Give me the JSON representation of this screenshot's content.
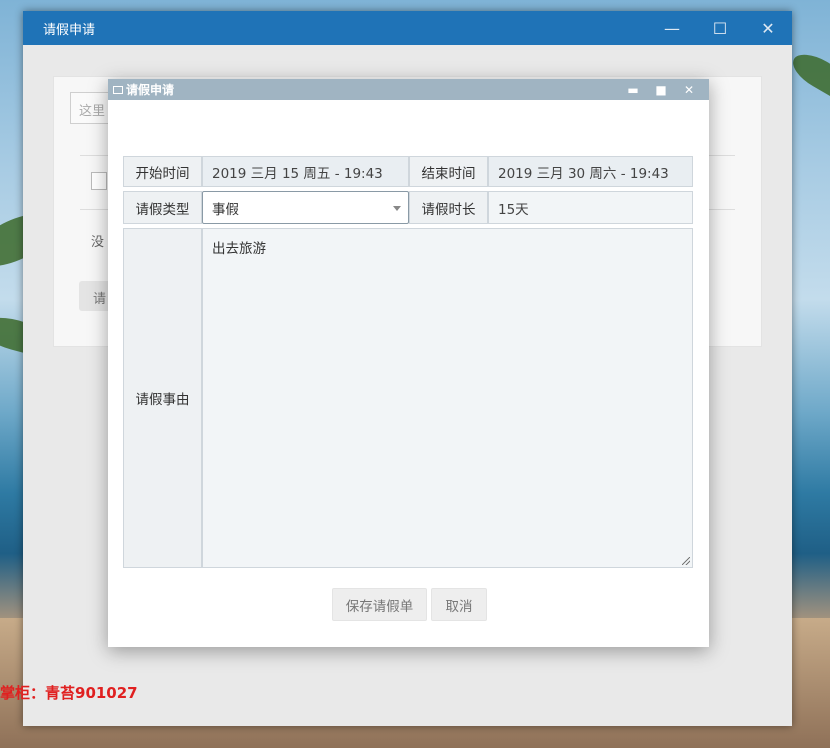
{
  "outer_window": {
    "title": "请假申请",
    "controls": {
      "minimize": "—",
      "maximize": "☐",
      "close": "✕"
    },
    "background": {
      "search_placeholder": "这里",
      "row_text": "没",
      "button_text": "请"
    }
  },
  "watermark": "掌柜：青苔901027",
  "dialog": {
    "title": "请假申请",
    "controls": {
      "minimize": "▬",
      "maximize": "■",
      "close": "✕"
    },
    "form": {
      "start_time_label": "开始时间",
      "start_time_value": "2019 三月 15 周五 - 19:43",
      "end_time_label": "结束时间",
      "end_time_value": "2019 三月 30 周六 - 19:43",
      "leave_type_label": "请假类型",
      "leave_type_value": "事假",
      "duration_label": "请假时长",
      "duration_value": "15天",
      "reason_label": "请假事由",
      "reason_value": "出去旅游"
    },
    "buttons": {
      "save": "保存请假单",
      "cancel": "取消"
    }
  },
  "colors": {
    "outer_titlebar": "#1f73b7",
    "dialog_titlebar": "#a0b4c2",
    "watermark": "#e02020"
  }
}
